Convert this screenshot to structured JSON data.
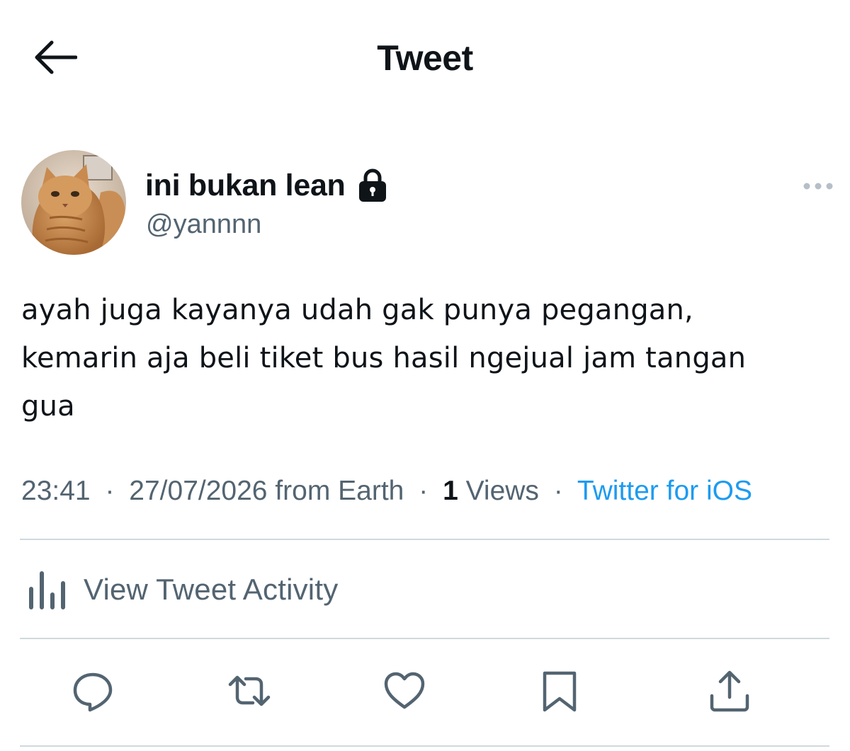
{
  "header": {
    "back_icon": "arrow-left-icon",
    "title": "Tweet"
  },
  "author": {
    "display_name": "ini bukan lean",
    "protected_icon": "lock-icon",
    "handle": "@yannnn",
    "more_icon": "more-horizontal-icon"
  },
  "tweet": {
    "text": "ayah juga kayanya udah gak punya pegangan,\nkemarin aja beli tiket bus hasil ngejual jam tangan\ngua"
  },
  "meta": {
    "time": "23:41",
    "separator": "·",
    "date": "27/07/2026 from Earth",
    "views_count": "1",
    "views_label": "Views",
    "source": "Twitter for iOS"
  },
  "activity": {
    "icon": "bar-chart-icon",
    "label": "View Tweet Activity"
  },
  "actions": [
    {
      "name": "reply",
      "icon": "reply-icon"
    },
    {
      "name": "retweet",
      "icon": "retweet-icon"
    },
    {
      "name": "like",
      "icon": "heart-icon"
    },
    {
      "name": "bookmark",
      "icon": "bookmark-icon"
    },
    {
      "name": "share",
      "icon": "share-icon"
    }
  ],
  "colors": {
    "text_primary": "#0f1419",
    "text_secondary": "#536471",
    "link": "#1d9bf0",
    "divider": "#cfd9de"
  }
}
